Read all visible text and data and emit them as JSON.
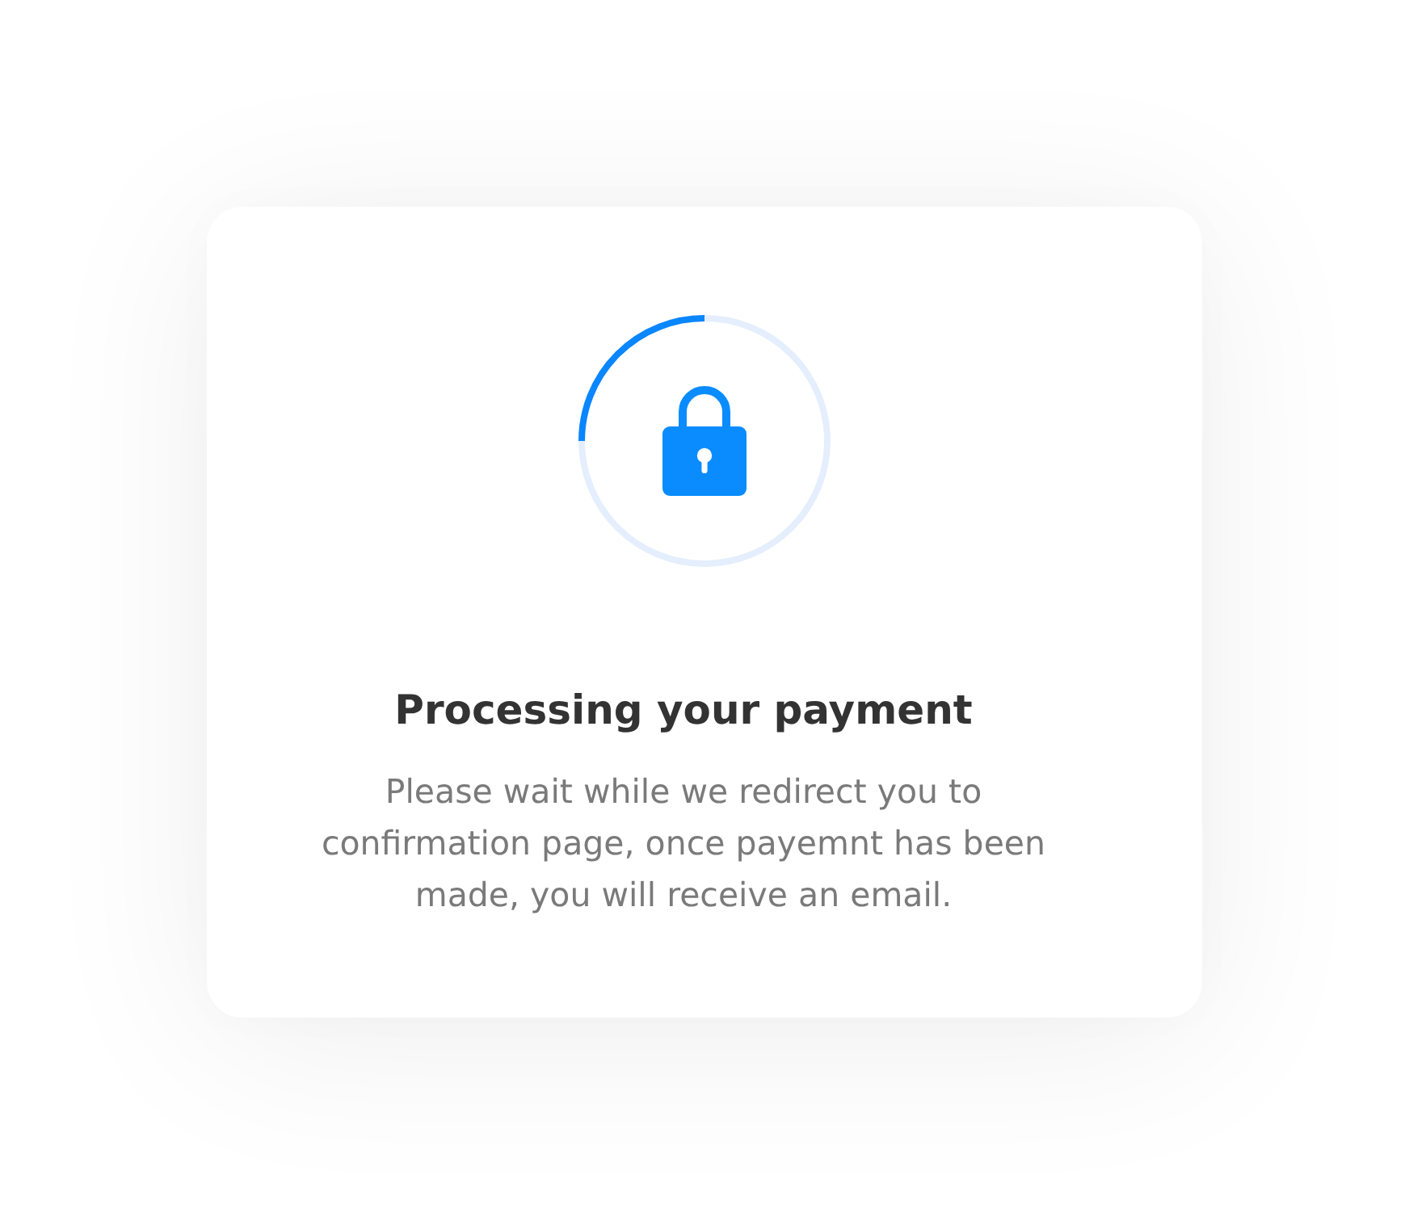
{
  "dialog": {
    "title": "Processing your payment",
    "message": "Please wait while we redirect you to confirmation page, once payemnt has been made, you will receive an email."
  }
}
